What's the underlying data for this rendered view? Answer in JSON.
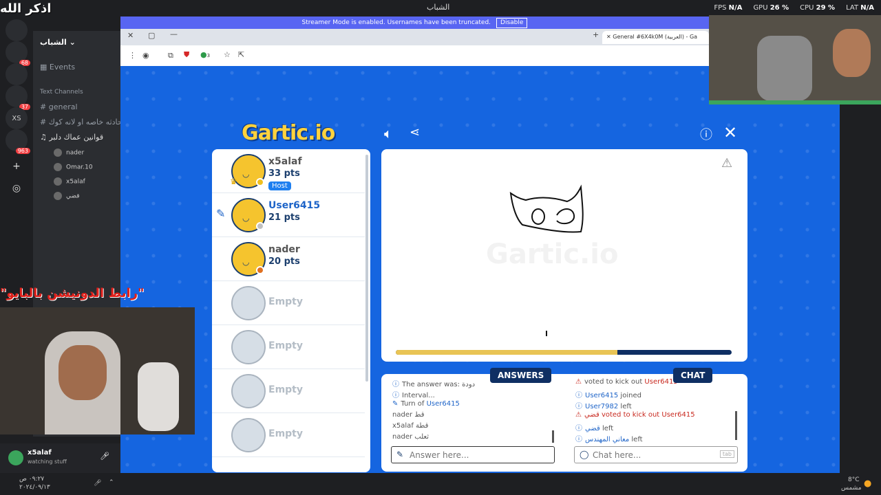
{
  "overlay": {
    "dhikr": "اذكر الله",
    "donation_link": "\"رابط الدونيشن بالبايو\""
  },
  "os_bar": {
    "app_title": "الشباب",
    "stats": [
      {
        "label": "FPS",
        "value": "N/A"
      },
      {
        "label": "GPU",
        "value": "26 %"
      },
      {
        "label": "CPU",
        "value": "29 %"
      },
      {
        "label": "LAT",
        "value": "N/A"
      }
    ]
  },
  "discord": {
    "servers": [
      {
        "name": "discord-home",
        "badge": ""
      },
      {
        "name": "server-1",
        "badge": "68"
      },
      {
        "name": "server-2",
        "badge": ""
      },
      {
        "name": "server-3",
        "badge": "37"
      },
      {
        "name": "XS",
        "badge": ""
      },
      {
        "name": "server-5",
        "badge": "963"
      }
    ],
    "server_name": "الشباب",
    "events": "Events",
    "text_channels_header": "Text Channels",
    "channels": [
      "general",
      "المحادثه خاصه او لانه كوك",
      "قوانين عماك دلبر"
    ],
    "voice_members": [
      "nader",
      "Omar.10",
      "x5alaf",
      "قضي"
    ],
    "user": {
      "name": "x5alaf",
      "status": "watching stuff"
    }
  },
  "banner": {
    "text": "Streamer Mode is enabled. Usernames have been truncated.",
    "disable_label": "Disable"
  },
  "browser": {
    "tab_title": "General #6X4k0M (العربية) - Ga",
    "extension_count": "3"
  },
  "game": {
    "logo": "Gartic.io",
    "players": [
      {
        "name": "x5alaf",
        "pts": "33 pts",
        "host": "Host",
        "color": "#f5c42e",
        "dot": "#f0c020",
        "drawing": false
      },
      {
        "name": "User6415",
        "pts": "21 pts",
        "host": "",
        "color": "#f5c42e",
        "dot": "#c0c0c0",
        "drawing": true
      },
      {
        "name": "nader",
        "pts": "20 pts",
        "host": "",
        "color": "#f5c42e",
        "dot": "#e07020",
        "drawing": false
      }
    ],
    "empty_label": "Empty",
    "empty_count": 4,
    "progress": 0.66,
    "answers_label": "ANSWERS",
    "chat_label": "CHAT",
    "answers": [
      {
        "icon": "ⓘ",
        "parts": [
          {
            "t": "The answer was: ",
            "c": ""
          },
          {
            "t": "دودة",
            "c": ""
          }
        ]
      },
      {
        "icon": "ⓘ",
        "parts": [
          {
            "t": "Interval...",
            "c": ""
          }
        ]
      },
      {
        "icon": "✎",
        "parts": [
          {
            "t": "Turn of ",
            "c": ""
          },
          {
            "t": "User6415",
            "c": "blue"
          }
        ]
      },
      {
        "icon": "",
        "parts": [
          {
            "t": "nader ",
            "c": ""
          },
          {
            "t": "قط",
            "c": ""
          }
        ]
      },
      {
        "icon": "",
        "parts": [
          {
            "t": "x5alaf ",
            "c": ""
          },
          {
            "t": "قطة",
            "c": ""
          }
        ]
      },
      {
        "icon": "",
        "parts": [
          {
            "t": "nader ",
            "c": ""
          },
          {
            "t": "ثعلب",
            "c": ""
          }
        ]
      }
    ],
    "chat": [
      {
        "icon": "⚠",
        "parts": [
          {
            "t": "voted to kick out ",
            "c": ""
          },
          {
            "t": "User6415",
            "c": "red"
          }
        ]
      },
      {
        "icon": "ⓘ",
        "parts": [
          {
            "t": "User6415",
            "c": "blue"
          },
          {
            "t": " joined",
            "c": ""
          }
        ]
      },
      {
        "icon": "ⓘ",
        "parts": [
          {
            "t": "User7982",
            "c": "blue"
          },
          {
            "t": " left",
            "c": ""
          }
        ]
      },
      {
        "icon": "⚠",
        "parts": [
          {
            "t": "قضي",
            "c": "red"
          },
          {
            "t": " voted to kick out ",
            "c": "red"
          },
          {
            "t": "User6415",
            "c": "red"
          }
        ]
      },
      {
        "icon": "ⓘ",
        "parts": [
          {
            "t": "قضي",
            "c": "blue"
          },
          {
            "t": " left",
            "c": ""
          }
        ]
      },
      {
        "icon": "ⓘ",
        "parts": [
          {
            "t": "معاني المهندس",
            "c": "blue"
          },
          {
            "t": " left",
            "c": ""
          }
        ]
      }
    ],
    "answer_placeholder": "Answer here...",
    "chat_placeholder": "Chat here...",
    "tab_hint": "tab"
  },
  "taskbar": {
    "time": "٠٩:٢٧ ص",
    "date": "٢٠٢٤/٠٩/١٣",
    "temp": "8°C",
    "weather": "مشمس"
  }
}
